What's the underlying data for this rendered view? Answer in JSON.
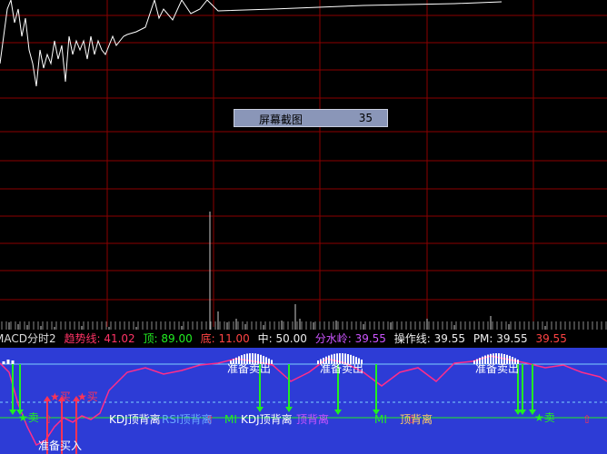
{
  "tooltip": {
    "label": "屏幕截图",
    "value": "35"
  },
  "status": {
    "indicator": "MACD分时2",
    "trend_label": "趋势线:",
    "trend_value": "41.02",
    "top_label": "顶:",
    "top_value": "89.00",
    "bottom_label": "底:",
    "bottom_value": "11.00",
    "mid_label": "中:",
    "mid_value": "50.00",
    "watershed_label": "分水岭:",
    "watershed_value": "39.55",
    "opline_label": "操作线:",
    "opline_value": "39.55",
    "pm_label": "PM:",
    "pm_value": "39.55",
    "last_value": "39.55"
  },
  "signals": {
    "prepare_sell_1": "准备卖出",
    "prepare_sell_2": "准备卖出",
    "prepare_sell_3": "准备卖出",
    "prepare_buy": "准备买入",
    "star_sell_1": "★卖",
    "star_sell_2": "★卖",
    "star_buy_1": "★买",
    "star_buy_2": "★买",
    "kdj_top_div_1": "KDJ顶背离",
    "kdj_top_div_2": "KDJ顶背离",
    "rsi_top_div": "RSI顶背离",
    "mi_1": "MI",
    "mi_2": "MI",
    "macd_top_div": "顶背离",
    "other_div": "顶背离"
  },
  "colors": {
    "background": "#000000",
    "grid": "#8b0000",
    "indicator_bg": "#2d3cd6",
    "price_line": "#ffffff",
    "pink_line": "#ff2d8a",
    "signal_green": "#22ee22",
    "sell_text": "#ffffff"
  }
}
